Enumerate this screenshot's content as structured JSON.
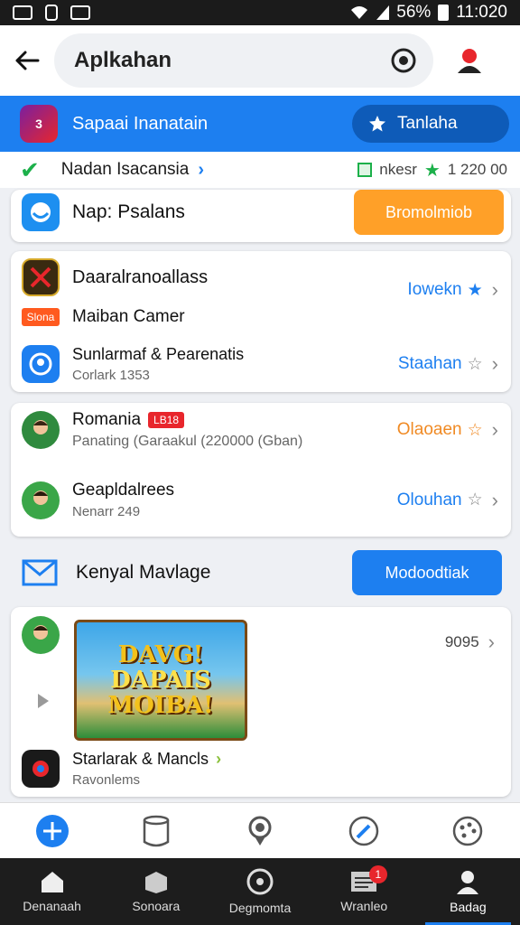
{
  "statusbar": {
    "battery": "56%",
    "time": "11:020"
  },
  "search": {
    "query": "Aplkahan"
  },
  "highlight": {
    "title": "Sapaai Inanatain",
    "button": "Tanlaha",
    "icon_text": "3"
  },
  "promo": {
    "label": "Nadan Isacansia",
    "right_text": "nkesr",
    "count": "1 220 00"
  },
  "card1": {
    "title": "Nap: Psalans",
    "button": "Bromolmiob"
  },
  "card2": {
    "row1_title": "Daaralranoallass",
    "row1_action": "Iowekn",
    "row2_badge": "Slona",
    "row2_title": "Maiban Camer",
    "row3_title": "Sunlarmaf & Pearenatis",
    "row3_sub": "Corlark 1353",
    "row3_action": "Staahan"
  },
  "card3": {
    "row1_title": "Romania",
    "row1_badge": "LB18",
    "row1_sub": "Panating (Garaakul (220000 (Gban)",
    "row1_action": "Olaoaen",
    "row2_title": "Geapldalrees",
    "row2_sub": "Nenarr 249",
    "row2_action": "Olouhan"
  },
  "mail": {
    "label": "Kenyal Mavlage",
    "button": "Modoodtiak"
  },
  "card4": {
    "count": "9095",
    "banner_line1": "DAVG!",
    "banner_line2": "DAPAIS",
    "banner_line3": "MOIBA!",
    "row_title": "Starlarak & Mancls",
    "row_sub": "Ravonlems"
  },
  "nav": [
    {
      "label": "Denanaah"
    },
    {
      "label": "Sonoara"
    },
    {
      "label": "Degmomta"
    },
    {
      "label": "Wranleo",
      "badge": "1"
    },
    {
      "label": "Badag"
    }
  ],
  "colors": {
    "accent": "#1d7ff0",
    "orange": "#ffa028",
    "green": "#1cb04a",
    "red": "#e8262c"
  },
  "icons": [
    "back-arrow-icon",
    "target-icon",
    "user-icon",
    "star-icon",
    "check-icon",
    "chevron-right-icon",
    "mail-icon",
    "plus-icon",
    "cylinder-icon",
    "pin-icon",
    "tool-icon",
    "palette-icon",
    "home-icon",
    "box-icon",
    "disc-icon",
    "news-icon",
    "person-icon"
  ]
}
